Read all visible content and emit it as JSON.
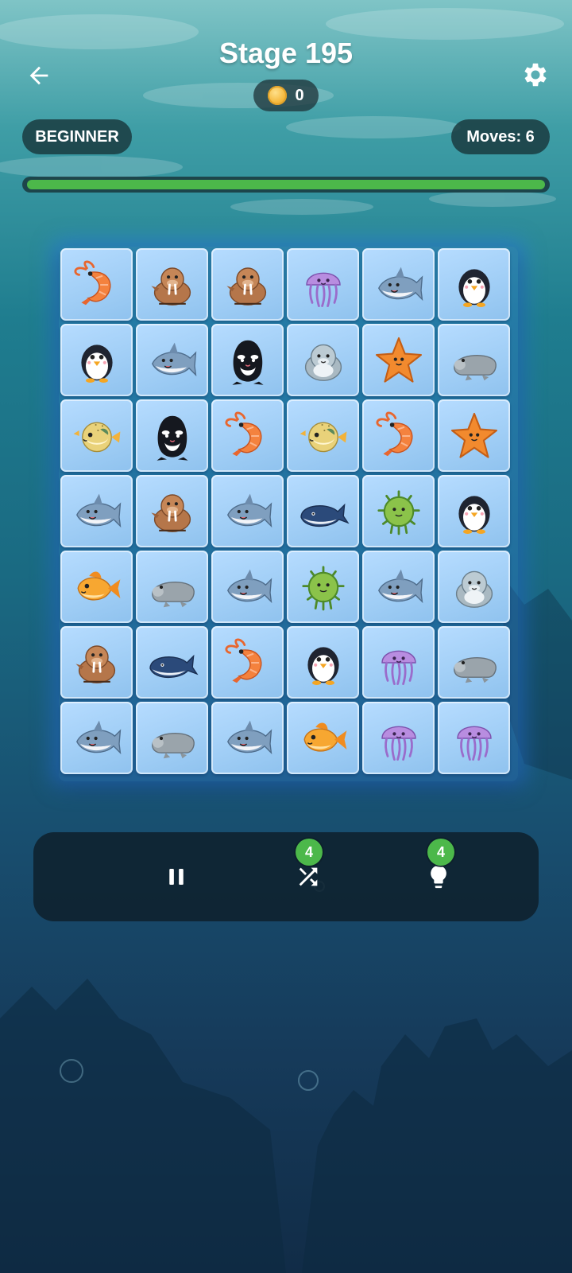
{
  "header": {
    "title": "Stage 195",
    "coins": "0",
    "difficulty": "BEGINNER",
    "moves_text": "Moves: 6",
    "progress": 1.0
  },
  "icons": {
    "back": "arrow-left-icon",
    "settings": "gear-icon",
    "coin": "coin-icon",
    "pause": "pause-icon",
    "shuffle": "shuffle-icon",
    "hint": "lightbulb-icon"
  },
  "board": {
    "rows": 7,
    "cols": 6,
    "tiles": [
      [
        "shrimp",
        "walrus",
        "walrus",
        "jellyfish",
        "shark",
        "penguin"
      ],
      [
        "penguin",
        "shark",
        "orca",
        "seal",
        "starfish",
        "manatee"
      ],
      [
        "pufferfish",
        "orca",
        "shrimp",
        "pufferfish",
        "shrimp",
        "starfish"
      ],
      [
        "shark",
        "walrus",
        "shark",
        "whale",
        "sea-urchin",
        "penguin"
      ],
      [
        "goldfish",
        "manatee",
        "shark",
        "sea-urchin",
        "shark",
        "seal"
      ],
      [
        "walrus",
        "whale",
        "shrimp",
        "penguin",
        "jellyfish",
        "manatee"
      ],
      [
        "shark",
        "manatee",
        "shark",
        "goldfish",
        "jellyfish",
        "jellyfish"
      ]
    ]
  },
  "toolbar": {
    "shuffle_count": "4",
    "hint_count": "4"
  },
  "colors": {
    "progress_fill": "#4cb84a",
    "badge": "#4cb84a",
    "tile": "#a6d2f8"
  }
}
